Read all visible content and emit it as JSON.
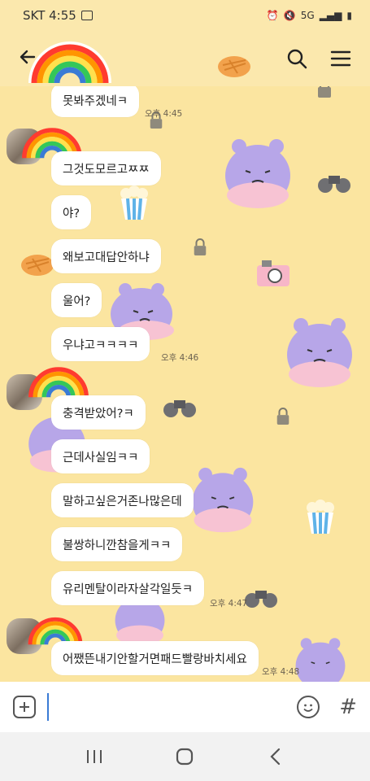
{
  "status_bar": {
    "carrier_time": "SKT 4:55",
    "network": "5G"
  },
  "header": {
    "back_icon": "back-arrow-icon",
    "search_icon": "search-icon",
    "menu_icon": "menu-icon"
  },
  "messages": [
    {
      "text": "못봐주겠네ㅋ",
      "time": "오후 4:45"
    },
    {
      "text": "그것도모르고ㅉㅉ",
      "time": ""
    },
    {
      "text": "야?",
      "time": ""
    },
    {
      "text": "왜보고대답안하냐",
      "time": ""
    },
    {
      "text": "울어?",
      "time": ""
    },
    {
      "text": "우냐고ㅋㅋㅋㅋ",
      "time": "오후 4:46"
    },
    {
      "text": "충격받았어?ㅋ",
      "time": ""
    },
    {
      "text": "근데사실임ㅋㅋ",
      "time": ""
    },
    {
      "text": "말하고싶은거존나많은데",
      "time": ""
    },
    {
      "text": "불쌍하니깐참을게ㅋㅋ",
      "time": ""
    },
    {
      "text": "유리멘탈이라자살각일듯ㅋ",
      "time": "오후 4:47"
    },
    {
      "text": "어쨌뜬내기안할거면패드빨랑바치세요",
      "time": "오후 4:48"
    }
  ],
  "input_bar": {
    "plus_icon": "plus-icon",
    "emoji_icon": "emoji-icon",
    "hash_label": "#",
    "placeholder": ""
  },
  "nav_bar": {
    "recents_icon": "recents-icon",
    "home_icon": "home-icon",
    "back_icon": "back-chevron-icon"
  },
  "colors": {
    "background": "#fbe5a0",
    "bubble": "#ffffff",
    "hippo": "#b7a6e8"
  }
}
